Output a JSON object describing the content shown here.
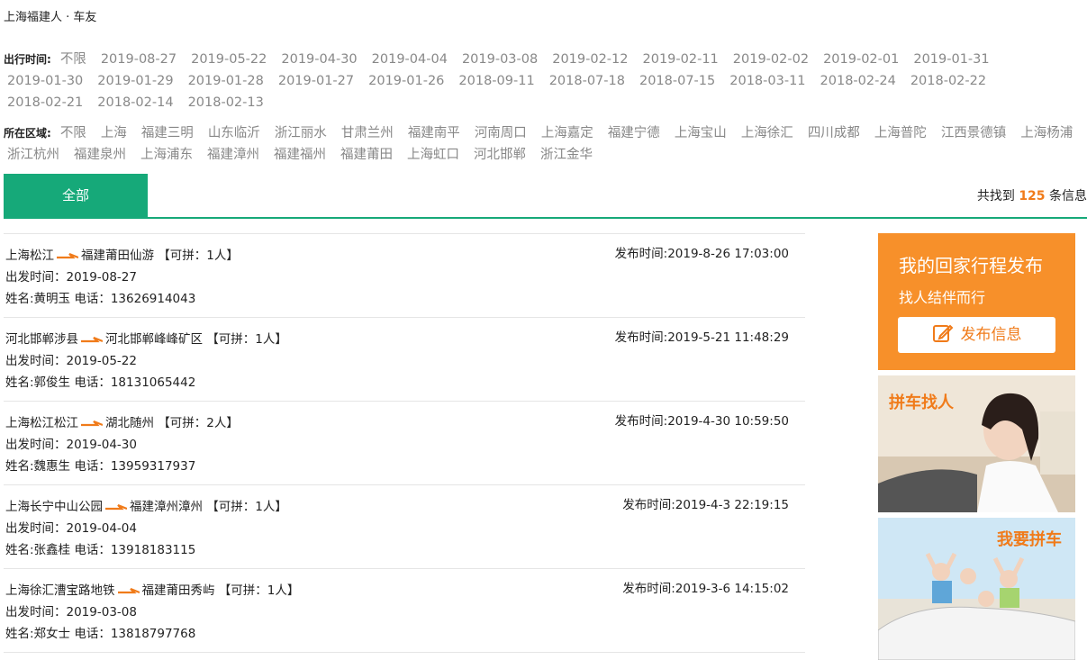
{
  "breadcrumb": "上海福建人 · 车友",
  "filters": {
    "date_label": "出行时间:",
    "dates": [
      "不限",
      "2019-08-27",
      "2019-05-22",
      "2019-04-30",
      "2019-04-04",
      "2019-03-08",
      "2019-02-12",
      "2019-02-11",
      "2019-02-02",
      "2019-02-01",
      "2019-01-31",
      "2019-01-30",
      "2019-01-29",
      "2019-01-28",
      "2019-01-27",
      "2019-01-26",
      "2018-09-11",
      "2018-07-18",
      "2018-07-15",
      "2018-03-11",
      "2018-02-24",
      "2018-02-22",
      "2018-02-21",
      "2018-02-14",
      "2018-02-13"
    ],
    "area_label": "所在区域:",
    "areas": [
      "不限",
      "上海",
      "福建三明",
      "山东临沂",
      "浙江丽水",
      "甘肃兰州",
      "福建南平",
      "河南周口",
      "上海嘉定",
      "福建宁德",
      "上海宝山",
      "上海徐汇",
      "四川成都",
      "上海普陀",
      "江西景德镇",
      "上海杨浦",
      "浙江杭州",
      "福建泉州",
      "上海浦东",
      "福建漳州",
      "福建福州",
      "福建莆田",
      "上海虹口",
      "河北邯郸",
      "浙江金华"
    ]
  },
  "tabs": {
    "all": "全部"
  },
  "found": {
    "prefix": "共找到 ",
    "count": "125",
    "suffix": " 条信息"
  },
  "listings": [
    {
      "from": "上海松江",
      "to": "福建莆田仙游",
      "seats": "【可拼：1人】",
      "depart": "出发时间：2019-08-27",
      "contact": "姓名:黄明玉 电话：13626914043",
      "published": "发布时间:2019-8-26 17:03:00"
    },
    {
      "from": "河北邯郸涉县",
      "to": "河北邯郸峰峰矿区",
      "seats": "【可拼：1人】",
      "depart": "出发时间：2019-05-22",
      "contact": "姓名:郭俊生 电话：18131065442",
      "published": "发布时间:2019-5-21 11:48:29"
    },
    {
      "from": "上海松江松江",
      "to": "湖北随州",
      "seats": "【可拼：2人】",
      "depart": "出发时间：2019-04-30",
      "contact": "姓名:魏惠生 电话：13959317937",
      "published": "发布时间:2019-4-30 10:59:50"
    },
    {
      "from": "上海长宁中山公园",
      "to": "福建漳州漳州",
      "seats": "【可拼：1人】",
      "depart": "出发时间：2019-04-04",
      "contact": "姓名:张鑫桂 电话：13918183115",
      "published": "发布时间:2019-4-3 22:19:15"
    },
    {
      "from": "上海徐汇漕宝路地铁",
      "to": "福建莆田秀屿",
      "seats": "【可拼：1人】",
      "depart": "出发时间：2019-03-08",
      "contact": "姓名:郑女士 电话：13818797768",
      "published": "发布时间:2019-3-6 14:15:02"
    }
  ],
  "sidebar": {
    "title": "我的回家行程发布",
    "subtitle": "找人结伴而行",
    "publish_button": "发布信息",
    "banner1_text": "拼车找人",
    "banner2_text": "我要拼车"
  },
  "colors": {
    "accent": "#16a979",
    "orange": "#f7902a",
    "arrow": "#f07b1a"
  }
}
